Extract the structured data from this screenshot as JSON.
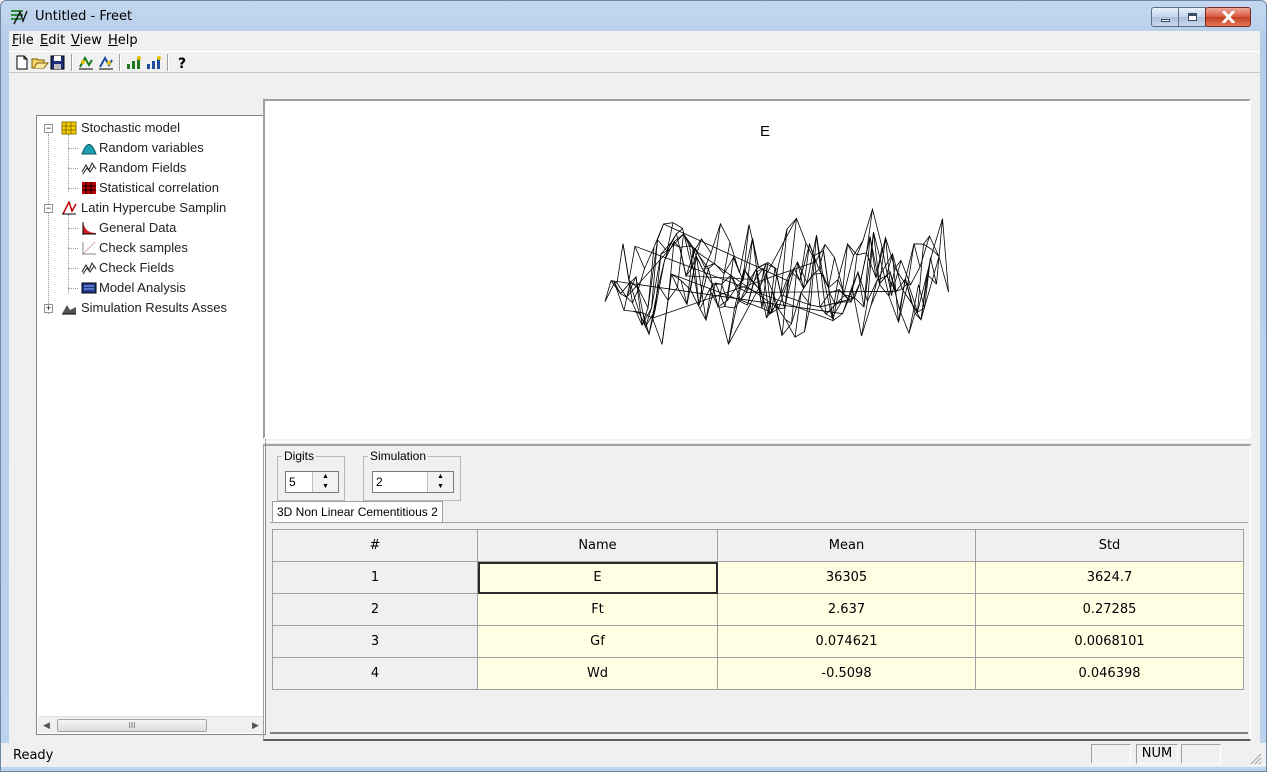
{
  "window": {
    "title": "Untitled - Freet"
  },
  "menu": [
    {
      "label": "File",
      "acc": "F",
      "rest": "ile"
    },
    {
      "label": "Edit",
      "acc": "E",
      "rest": "dit"
    },
    {
      "label": "View",
      "acc": "V",
      "rest": "iew"
    },
    {
      "label": "Help",
      "acc": "H",
      "rest": "elp"
    }
  ],
  "toolbar": {
    "buttons": [
      "new-file-icon",
      "open-folder-icon",
      "save-icon",
      "sampling-icon",
      "sampling-alt-icon",
      "analysis-icon",
      "analysis-alt-icon",
      "help-icon"
    ]
  },
  "tree": {
    "stochastic_model": "Stochastic model",
    "random_variables": "Random variables",
    "random_fields": "Random Fields",
    "statistical_correlation": "Statistical correlation",
    "latin_hypercube": "Latin Hypercube Samplin",
    "general_data": "General Data",
    "check_samples": "Check samples",
    "check_fields": "Check Fields",
    "model_analysis": "Model Analysis",
    "simulation_results": "Simulation Results Asses",
    "scroll_grip": "III"
  },
  "plot": {
    "title": "E"
  },
  "controls": {
    "digits_label": "Digits",
    "digits_value": "5",
    "simulation_label": "Simulation",
    "simulation_value": "2"
  },
  "tab": {
    "label": "3D Non Linear Cementitious 2"
  },
  "table": {
    "headers": [
      "#",
      "Name",
      "Mean",
      "Std"
    ],
    "rows": [
      [
        "1",
        "E",
        "36305",
        "3624.7"
      ],
      [
        "2",
        "Ft",
        "2.637",
        "0.27285"
      ],
      [
        "3",
        "Gf",
        "0.074621",
        "0.0068101"
      ],
      [
        "4",
        "Wd",
        "-0.5098",
        "0.046398"
      ]
    ]
  },
  "status": {
    "text": "Ready",
    "num": "NUM"
  },
  "colors": {
    "cell_bg": "#ffffe4",
    "titlebar": "#bcd3ee",
    "close": "#c43d21"
  }
}
